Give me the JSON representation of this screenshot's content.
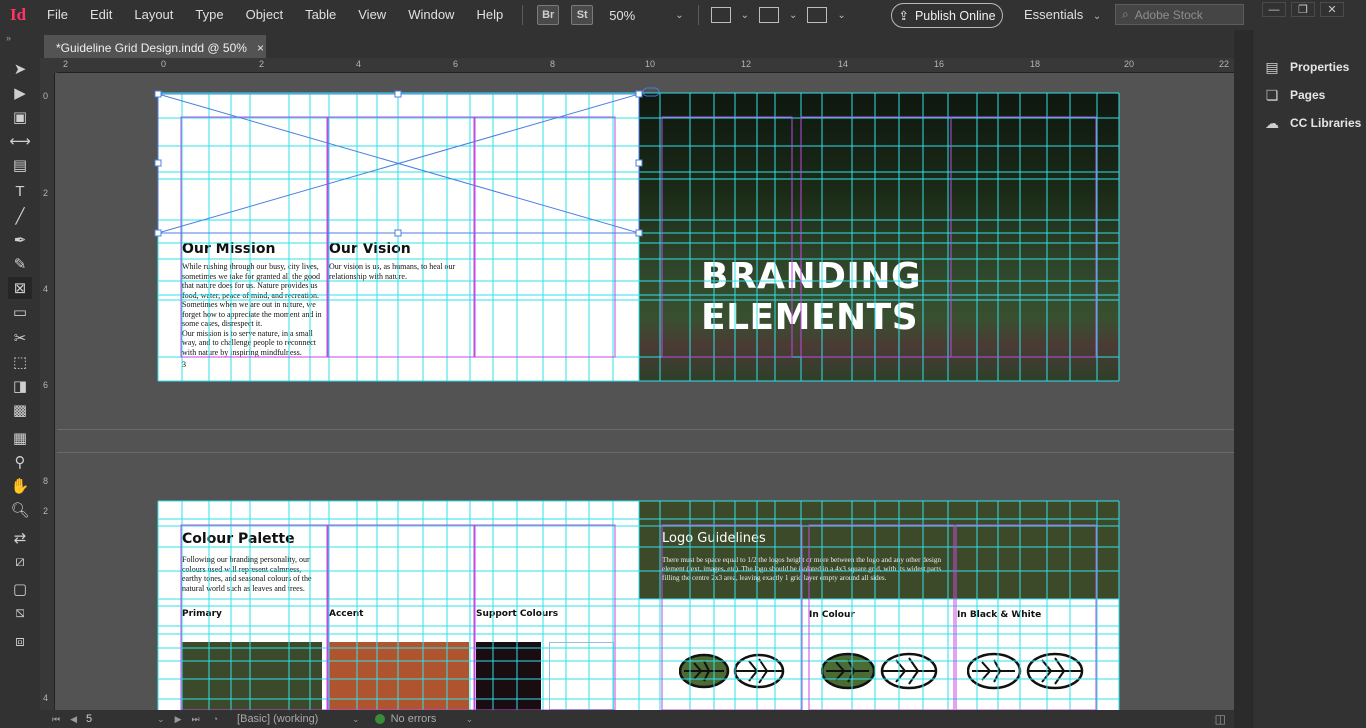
{
  "app": {
    "icon_label": "Id"
  },
  "menu": {
    "items": [
      "File",
      "Edit",
      "Layout",
      "Type",
      "Object",
      "Table",
      "View",
      "Window",
      "Help"
    ],
    "bridge_label": "Br",
    "stock_label": "St",
    "zoom": "50%",
    "publish_label": "Publish Online",
    "workspace": "Essentials",
    "search_placeholder": "Adobe Stock"
  },
  "tab": {
    "title": "*Guideline Grid Design.indd @ 50%",
    "close": "×"
  },
  "ruler_h": [
    "2",
    "0",
    "2",
    "4",
    "6",
    "8",
    "10",
    "12",
    "14",
    "16",
    "18",
    "20",
    "22"
  ],
  "ruler_v": [
    "0",
    "2",
    "4",
    "6",
    "8",
    "2",
    "4"
  ],
  "page1": {
    "mission_title": "Our Mission",
    "mission_body": "While rushing through our busy, city lives, sometimes we take for granted all the good that nature does for us. Nature provides us food, water, peace of mind, and recreation. Sometimes when we are out in nature, we forget how to appreciate the moment and in some cases, disrespect it.",
    "mission_body2": "Our mission is to serve nature, in a small way, and to challenge people to reconnect with nature by inspiring mindfulness.",
    "vision_title": "Our Vision",
    "vision_body": "Our vision is us, as humans, to heal our relationship with nature.",
    "page_number": "3"
  },
  "page2": {
    "title": "BRANDING ELEMENTS"
  },
  "page3": {
    "title": "Colour Palette",
    "body": "Following our branding personality, our colours used will represent calmness, earthy tones, and seasonal colours of the natural world such as leaves and trees.",
    "primary_label": "Primary",
    "accent_label": "Accent",
    "support_label": "Support Colours",
    "colors": {
      "primary": "#3a4a2a",
      "accent": "#b05430",
      "support": "#1a0d12"
    }
  },
  "page4": {
    "title": "Logo Guidelines",
    "body": "There must be space equal to 1/2 the logos height or more between the logo and any other design element (text, images, etc). The logo should be isolated in a 4x3 square grid, with its widest parts filling the centre 2x3 area, leaving exactly 1 grid layer empty around all sides.",
    "in_colour_label": "In Colour",
    "bw_label": "In Black & White"
  },
  "panel": {
    "items": [
      "Properties",
      "Pages",
      "CC Libraries"
    ]
  },
  "status": {
    "page": "5",
    "master": "[Basic] (working)",
    "preflight": "No errors"
  }
}
